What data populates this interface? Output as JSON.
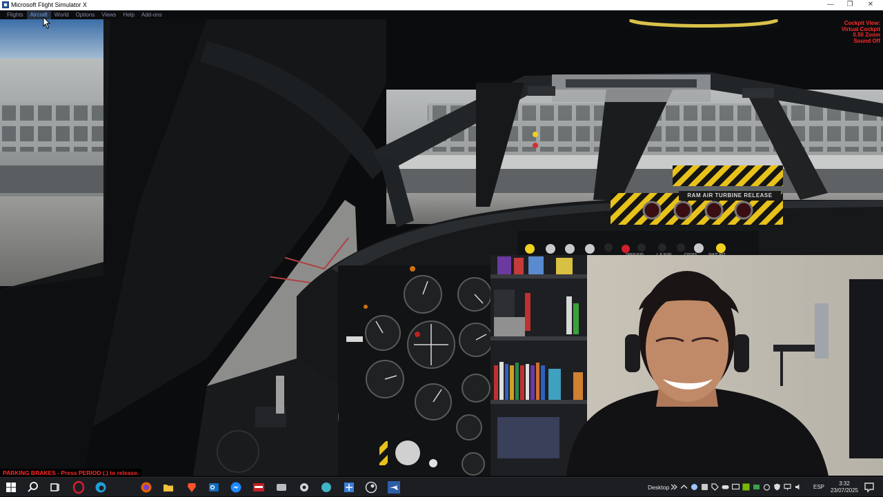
{
  "window": {
    "title": "Microsoft Flight Simulator X",
    "controls": [
      "minimize-icon",
      "restore-icon",
      "close-icon"
    ]
  },
  "menu": {
    "items": [
      "Flights",
      "Aircraft",
      "World",
      "Options",
      "Views",
      "Help",
      "Add-ons"
    ],
    "hovered": "Aircraft"
  },
  "cockpit": {
    "view_info": [
      "Cockpit View:",
      "Virtual Cockpit",
      "0.50 Zoom",
      "Sound Off"
    ],
    "ram_air_label": "RAM AIR TURBINE RELEASE",
    "panel_labels": [
      "OPEN FUD",
      "L.P. FUEL",
      "COCKS",
      "SHUT AFT"
    ]
  },
  "status": {
    "parking_brake_message": "PARKING BRAKES - Press PERIOD (.) to release."
  },
  "taskbar": {
    "pinned_apps": [
      "windows-start-icon",
      "search-icon",
      "task-view-icon",
      "opera-icon",
      "edge-icon",
      "firefox-icon",
      "file-explorer-icon",
      "brave-icon",
      "outlook-icon",
      "messenger-icon",
      "video-app-icon",
      "recorder-icon",
      "gear-app-icon",
      "sphere-app-icon",
      "grid-app-icon",
      "steam-icon",
      "flight-simulator-icon"
    ],
    "active_app": "flight-simulator-icon",
    "desktop_label": "Desktop",
    "language": "ESP",
    "time": "3:32",
    "date": "23/07/2025"
  },
  "colors": {
    "overlay_text": "#ff2a2a",
    "menu_text": "#8a8aa6",
    "menu_hover": "#6f9fe4",
    "taskbar_bg": "#1d1e22",
    "hazard_yellow": "#e8c21a"
  }
}
